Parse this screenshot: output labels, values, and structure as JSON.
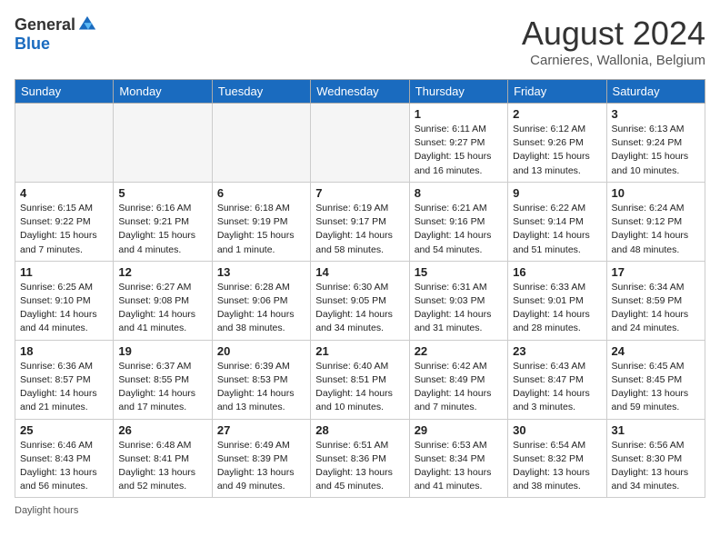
{
  "logo": {
    "general": "General",
    "blue": "Blue"
  },
  "header": {
    "month_year": "August 2024",
    "location": "Carnieres, Wallonia, Belgium"
  },
  "days_of_week": [
    "Sunday",
    "Monday",
    "Tuesday",
    "Wednesday",
    "Thursday",
    "Friday",
    "Saturday"
  ],
  "weeks": [
    [
      {
        "day": "",
        "info": ""
      },
      {
        "day": "",
        "info": ""
      },
      {
        "day": "",
        "info": ""
      },
      {
        "day": "",
        "info": ""
      },
      {
        "day": "1",
        "info": "Sunrise: 6:11 AM\nSunset: 9:27 PM\nDaylight: 15 hours and 16 minutes."
      },
      {
        "day": "2",
        "info": "Sunrise: 6:12 AM\nSunset: 9:26 PM\nDaylight: 15 hours and 13 minutes."
      },
      {
        "day": "3",
        "info": "Sunrise: 6:13 AM\nSunset: 9:24 PM\nDaylight: 15 hours and 10 minutes."
      }
    ],
    [
      {
        "day": "4",
        "info": "Sunrise: 6:15 AM\nSunset: 9:22 PM\nDaylight: 15 hours and 7 minutes."
      },
      {
        "day": "5",
        "info": "Sunrise: 6:16 AM\nSunset: 9:21 PM\nDaylight: 15 hours and 4 minutes."
      },
      {
        "day": "6",
        "info": "Sunrise: 6:18 AM\nSunset: 9:19 PM\nDaylight: 15 hours and 1 minute."
      },
      {
        "day": "7",
        "info": "Sunrise: 6:19 AM\nSunset: 9:17 PM\nDaylight: 14 hours and 58 minutes."
      },
      {
        "day": "8",
        "info": "Sunrise: 6:21 AM\nSunset: 9:16 PM\nDaylight: 14 hours and 54 minutes."
      },
      {
        "day": "9",
        "info": "Sunrise: 6:22 AM\nSunset: 9:14 PM\nDaylight: 14 hours and 51 minutes."
      },
      {
        "day": "10",
        "info": "Sunrise: 6:24 AM\nSunset: 9:12 PM\nDaylight: 14 hours and 48 minutes."
      }
    ],
    [
      {
        "day": "11",
        "info": "Sunrise: 6:25 AM\nSunset: 9:10 PM\nDaylight: 14 hours and 44 minutes."
      },
      {
        "day": "12",
        "info": "Sunrise: 6:27 AM\nSunset: 9:08 PM\nDaylight: 14 hours and 41 minutes."
      },
      {
        "day": "13",
        "info": "Sunrise: 6:28 AM\nSunset: 9:06 PM\nDaylight: 14 hours and 38 minutes."
      },
      {
        "day": "14",
        "info": "Sunrise: 6:30 AM\nSunset: 9:05 PM\nDaylight: 14 hours and 34 minutes."
      },
      {
        "day": "15",
        "info": "Sunrise: 6:31 AM\nSunset: 9:03 PM\nDaylight: 14 hours and 31 minutes."
      },
      {
        "day": "16",
        "info": "Sunrise: 6:33 AM\nSunset: 9:01 PM\nDaylight: 14 hours and 28 minutes."
      },
      {
        "day": "17",
        "info": "Sunrise: 6:34 AM\nSunset: 8:59 PM\nDaylight: 14 hours and 24 minutes."
      }
    ],
    [
      {
        "day": "18",
        "info": "Sunrise: 6:36 AM\nSunset: 8:57 PM\nDaylight: 14 hours and 21 minutes."
      },
      {
        "day": "19",
        "info": "Sunrise: 6:37 AM\nSunset: 8:55 PM\nDaylight: 14 hours and 17 minutes."
      },
      {
        "day": "20",
        "info": "Sunrise: 6:39 AM\nSunset: 8:53 PM\nDaylight: 14 hours and 13 minutes."
      },
      {
        "day": "21",
        "info": "Sunrise: 6:40 AM\nSunset: 8:51 PM\nDaylight: 14 hours and 10 minutes."
      },
      {
        "day": "22",
        "info": "Sunrise: 6:42 AM\nSunset: 8:49 PM\nDaylight: 14 hours and 7 minutes."
      },
      {
        "day": "23",
        "info": "Sunrise: 6:43 AM\nSunset: 8:47 PM\nDaylight: 14 hours and 3 minutes."
      },
      {
        "day": "24",
        "info": "Sunrise: 6:45 AM\nSunset: 8:45 PM\nDaylight: 13 hours and 59 minutes."
      }
    ],
    [
      {
        "day": "25",
        "info": "Sunrise: 6:46 AM\nSunset: 8:43 PM\nDaylight: 13 hours and 56 minutes."
      },
      {
        "day": "26",
        "info": "Sunrise: 6:48 AM\nSunset: 8:41 PM\nDaylight: 13 hours and 52 minutes."
      },
      {
        "day": "27",
        "info": "Sunrise: 6:49 AM\nSunset: 8:39 PM\nDaylight: 13 hours and 49 minutes."
      },
      {
        "day": "28",
        "info": "Sunrise: 6:51 AM\nSunset: 8:36 PM\nDaylight: 13 hours and 45 minutes."
      },
      {
        "day": "29",
        "info": "Sunrise: 6:53 AM\nSunset: 8:34 PM\nDaylight: 13 hours and 41 minutes."
      },
      {
        "day": "30",
        "info": "Sunrise: 6:54 AM\nSunset: 8:32 PM\nDaylight: 13 hours and 38 minutes."
      },
      {
        "day": "31",
        "info": "Sunrise: 6:56 AM\nSunset: 8:30 PM\nDaylight: 13 hours and 34 minutes."
      }
    ]
  ],
  "footer": {
    "daylight_label": "Daylight hours"
  }
}
